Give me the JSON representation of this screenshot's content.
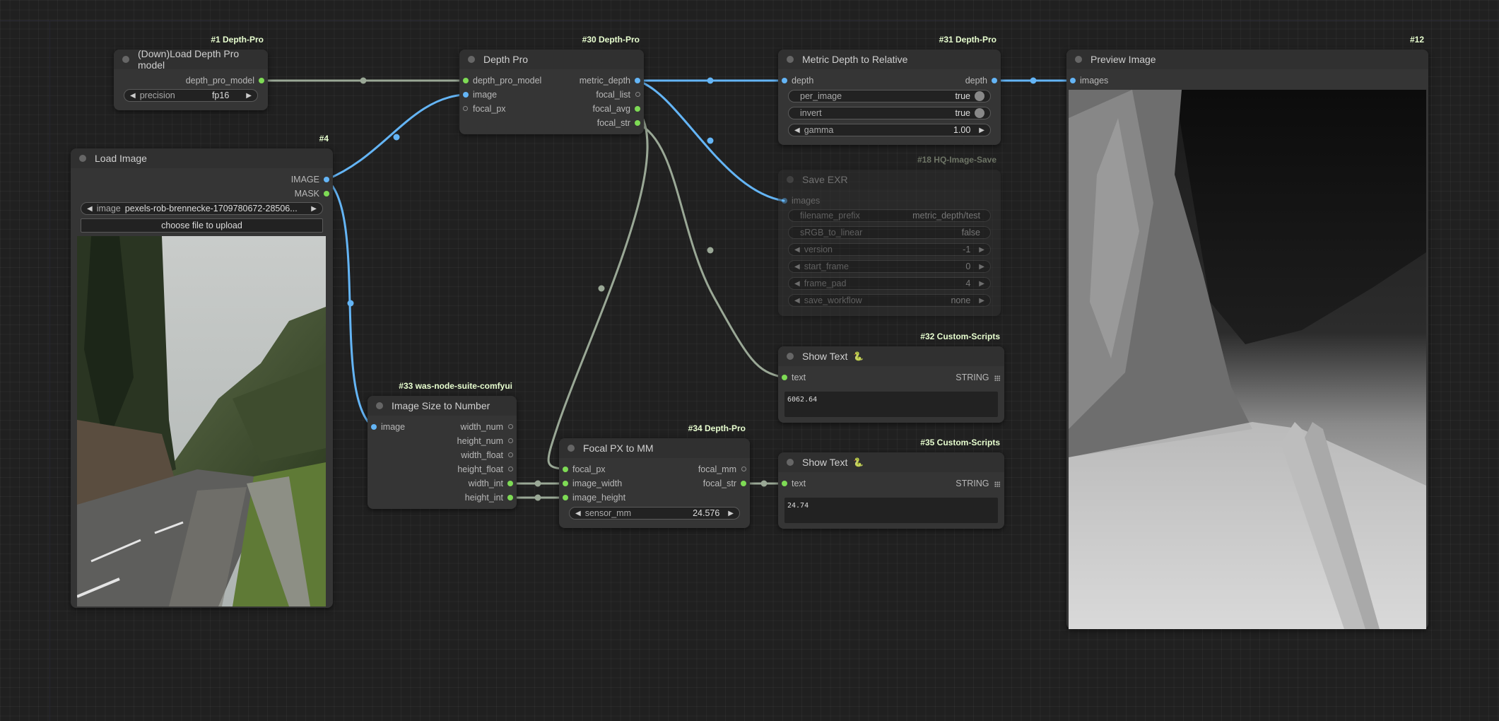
{
  "nodes": {
    "load_model": {
      "badge": "#1 Depth-Pro",
      "title": "(Down)Load Depth Pro model",
      "out_depth_pro_model": "depth_pro_model",
      "precision_label": "precision",
      "precision_value": "fp16"
    },
    "depth_pro": {
      "badge": "#30 Depth-Pro",
      "title": "Depth Pro",
      "in_depth_pro_model": "depth_pro_model",
      "in_image": "image",
      "in_focal_px": "focal_px",
      "out_metric_depth": "metric_depth",
      "out_focal_list": "focal_list",
      "out_focal_avg": "focal_avg",
      "out_focal_str": "focal_str"
    },
    "metric_to_relative": {
      "badge": "#31 Depth-Pro",
      "title": "Metric Depth to Relative",
      "in_depth": "depth",
      "out_depth": "depth",
      "per_image_label": "per_image",
      "per_image_value": "true",
      "invert_label": "invert",
      "invert_value": "true",
      "gamma_label": "gamma",
      "gamma_value": "1.00"
    },
    "save_exr": {
      "badge": "#18 HQ-Image-Save",
      "title": "Save EXR",
      "in_images": "images",
      "filename_prefix_label": "filename_prefix",
      "filename_prefix_value": "metric_depth/test",
      "srgb_label": "sRGB_to_linear",
      "srgb_value": "false",
      "version_label": "version",
      "version_value": "-1",
      "start_frame_label": "start_frame",
      "start_frame_value": "0",
      "frame_pad_label": "frame_pad",
      "frame_pad_value": "4",
      "save_workflow_label": "save_workflow",
      "save_workflow_value": "none"
    },
    "preview": {
      "badge": "#12",
      "title": "Preview Image",
      "in_images": "images"
    },
    "load_image": {
      "badge": "#4",
      "title": "Load Image",
      "out_image": "IMAGE",
      "out_mask": "MASK",
      "image_label": "image",
      "image_value": "pexels-rob-brennecke-1709780672-28506...",
      "upload_label": "choose file to upload"
    },
    "image_size": {
      "badge": "#33 was-node-suite-comfyui",
      "title": "Image Size to Number",
      "in_image": "image",
      "out_width_num": "width_num",
      "out_height_num": "height_num",
      "out_width_float": "width_float",
      "out_height_float": "height_float",
      "out_width_int": "width_int",
      "out_height_int": "height_int"
    },
    "focal_px_mm": {
      "badge": "#34 Depth-Pro",
      "title": "Focal PX to MM",
      "in_focal_px": "focal_px",
      "in_image_width": "image_width",
      "in_image_height": "image_height",
      "out_focal_mm": "focal_mm",
      "out_focal_str": "focal_str",
      "sensor_label": "sensor_mm",
      "sensor_value": "24.576"
    },
    "show_text_32": {
      "badge": "#32 Custom-Scripts",
      "title": "Show Text",
      "icon": "snake-icon",
      "in_text": "text",
      "out_string": "STRING",
      "value": "6062.64"
    },
    "show_text_35": {
      "badge": "#35 Custom-Scripts",
      "title": "Show Text",
      "icon": "snake-icon",
      "in_text": "text",
      "out_string": "STRING",
      "value": "24.74"
    }
  },
  "colors": {
    "canvas_bg": "#202020",
    "node_bg": "#353535",
    "image_link": "#64b5f6",
    "default_link": "#9aa896",
    "slot_green": "#7edb55",
    "badge_text": "#e8ffd0"
  }
}
